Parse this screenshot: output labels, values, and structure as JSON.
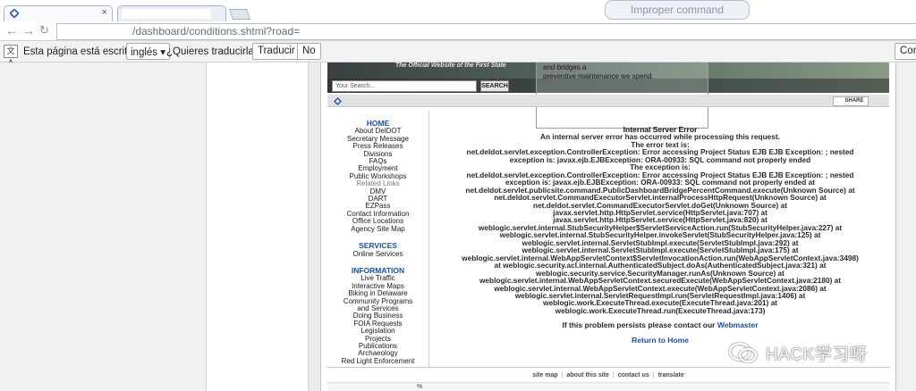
{
  "browser": {
    "ghost_popup": "Improper command",
    "address_path": "/dashboard/conditions.shtml?road="
  },
  "translate_bar": {
    "icon_glyph": "文A",
    "message": "Esta página está escrita en",
    "language": "inglés",
    "question": "¿Quieres traducirla?",
    "translate_button": "Traducir",
    "no_button": "No",
    "config_button": "Conf"
  },
  "site": {
    "tagline": "The Official Website of the First State",
    "search_placeholder": "Your Search...",
    "search_button": "SEARCH",
    "overlay_lines": [
      "and bridges a",
      "preventive maintenance we spend."
    ],
    "share_label": "SHARE"
  },
  "leftnav": {
    "home_heading": "HOME",
    "home_items": [
      {
        "label": "About DelDOT",
        "muted": false
      },
      {
        "label": "Secretary Message",
        "muted": false
      },
      {
        "label": "Press Releases",
        "muted": false
      },
      {
        "label": "Divisions",
        "muted": false
      },
      {
        "label": "FAQs",
        "muted": false
      },
      {
        "label": "Employment",
        "muted": false
      },
      {
        "label": "Public Workshops",
        "muted": false
      },
      {
        "label": "Related Links",
        "muted": true
      },
      {
        "label": "DMV",
        "muted": false
      },
      {
        "label": "DART",
        "muted": false
      },
      {
        "label": "EZPass",
        "muted": false
      },
      {
        "label": "Contact Information",
        "muted": false
      },
      {
        "label": "Office Locations",
        "muted": false
      },
      {
        "label": "Agency Site Map",
        "muted": false
      }
    ],
    "services_heading": "SERVICES",
    "services_items": [
      {
        "label": "Online Services",
        "muted": false
      }
    ],
    "information_heading": "INFORMATION",
    "information_items": [
      {
        "label": "Live Traffic",
        "muted": false
      },
      {
        "label": "Interactive Maps",
        "muted": false
      },
      {
        "label": "Biking in Delaware",
        "muted": false
      },
      {
        "label": "Community Programs",
        "muted": false
      },
      {
        "label": "and Services",
        "muted": false
      },
      {
        "label": "Doing Business",
        "muted": false
      },
      {
        "label": "FOIA Requests",
        "muted": false
      },
      {
        "label": "Legislation",
        "muted": false
      },
      {
        "label": "Projects",
        "muted": false
      },
      {
        "label": "Publications",
        "muted": false
      },
      {
        "label": "Archaeology",
        "muted": false
      },
      {
        "label": "Red Light Enforcement",
        "muted": false
      }
    ]
  },
  "error": {
    "title": "Internal Server Error",
    "subtitle": "An internal server error has occurred while processing this request.",
    "error_text_label": "The error text is:",
    "error_text_lines": [
      "net.deldot.servlet.exception.ControllerException: Error accessing Project Status EJB EJB Exception: ; nested",
      "exception is: javax.ejb.EJBException: ORA-00933: SQL command not properly ended"
    ],
    "exception_label": "The exception is:",
    "exception_lines": [
      "net.deldot.servlet.exception.ControllerException: Error accessing Project Status EJB EJB Exception: ; nested",
      "exception is: javax.ejb.EJBException: ORA-00933: SQL command not properly ended at",
      "net.deldot.servlet.publicsite.command.PublicDashboardBridgePercentCommand.execute(Unknown Source) at",
      "net.deldot.servlet.CommandExecutorServlet.internalProcessHttpRequest(Unknown Source) at",
      "net.deldot.servlet.CommandExecutorServlet.doGet(Unknown Source) at",
      "javax.servlet.http.HttpServlet.service(HttpServlet.java:707) at",
      "javax.servlet.http.HttpServlet.service(HttpServlet.java:820) at",
      "weblogic.servlet.internal.StubSecurityHelper$ServletServiceAction.run(StubSecurityHelper.java:227) at",
      "weblogic.servlet.internal.StubSecurityHelper.invokeServlet(StubSecurityHelper.java:125) at",
      "weblogic.servlet.internal.ServletStubImpl.execute(ServletStubImpl.java:292) at",
      "weblogic.servlet.internal.ServletStubImpl.execute(ServletStubImpl.java:175) at",
      "weblogic.servlet.internal.WebAppServletContext$ServletInvocationAction.run(WebAppServletContext.java:3498)",
      "at weblogic.security.acl.internal.AuthenticatedSubject.doAs(AuthenticatedSubject.java:321) at",
      "weblogic.security.service.SecurityManager.runAs(Unknown Source) at",
      "weblogic.servlet.internal.WebAppServletContext.securedExecute(WebAppServletContext.java:2180) at",
      "weblogic.servlet.internal.WebAppServletContext.execute(WebAppServletContext.java:2086) at",
      "weblogic.servlet.internal.ServletRequestImpl.run(ServletRequestImpl.java:1406) at",
      "weblogic.work.ExecuteThread.execute(ExecuteThread.java:201) at",
      "weblogic.work.ExecuteThread.run(ExecuteThread.java:173)"
    ],
    "persist_text": "If this problem persists please contact our ",
    "webmaster_link": "Webmaster",
    "return_home": "Return to Home"
  },
  "footer": {
    "links": [
      "site map",
      "about this site",
      "contact us",
      "translate"
    ],
    "separator": "|",
    "percent_fragment": "%"
  },
  "watermark": {
    "text": "HACK学习呀"
  },
  "colors": {
    "link_blue": "#1e4fa8",
    "nav_heading": "#1e4fa8",
    "share_icon": "#e4541c"
  }
}
